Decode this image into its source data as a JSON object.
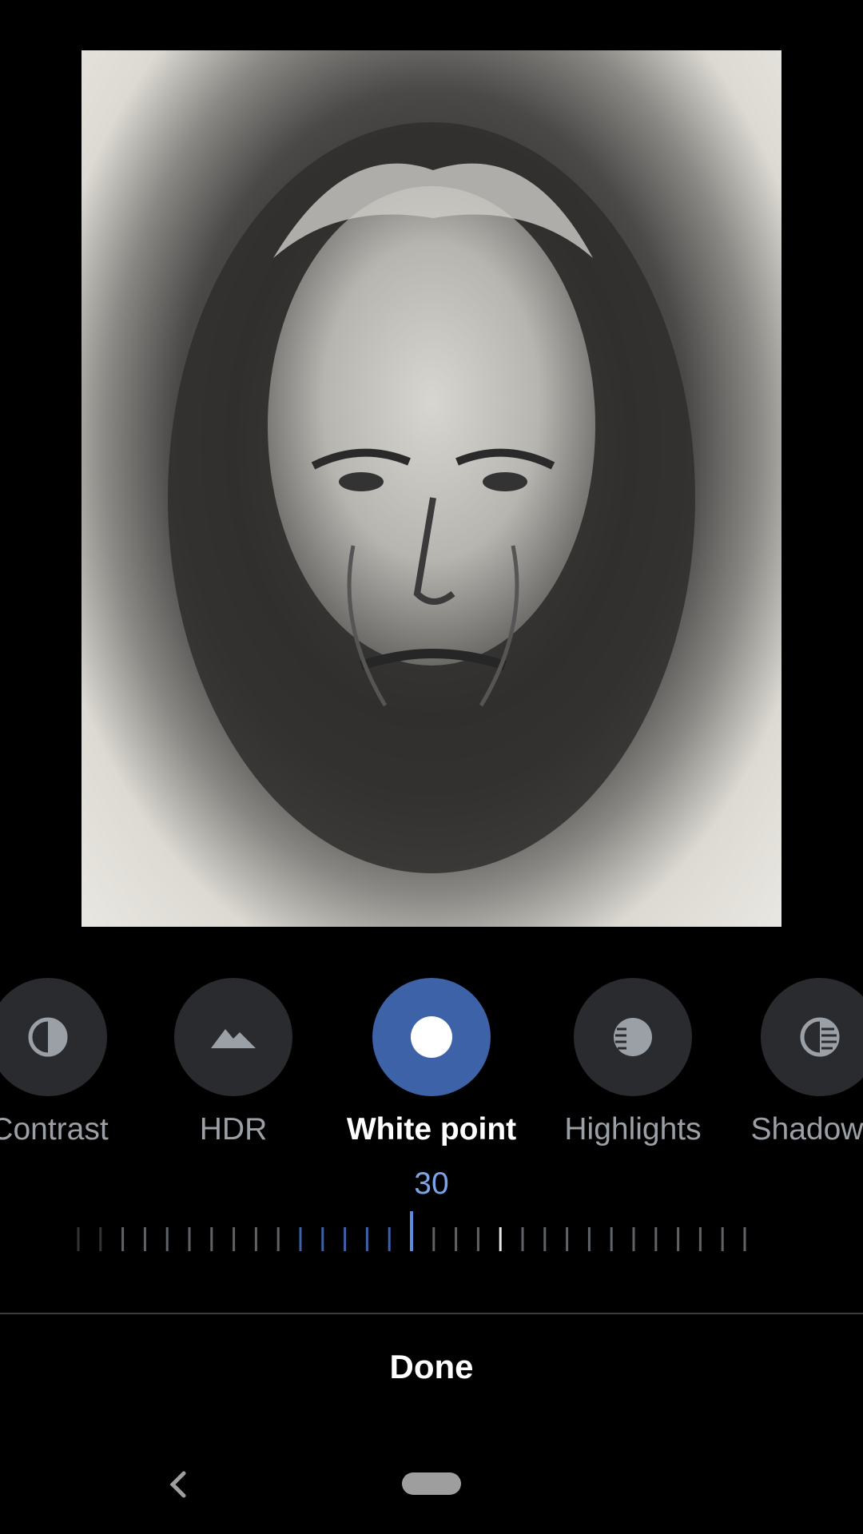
{
  "tools": [
    {
      "label": "Contrast",
      "icon": "contrast-icon",
      "active": false
    },
    {
      "label": "HDR",
      "icon": "mountain-icon",
      "active": false
    },
    {
      "label": "White point",
      "icon": "white-point-icon",
      "active": true
    },
    {
      "label": "Highlights",
      "icon": "highlights-icon",
      "active": false
    },
    {
      "label": "Shadow",
      "icon": "shadows-icon",
      "active": false
    }
  ],
  "slider": {
    "value": "30"
  },
  "done_label": "Done",
  "nav": {
    "back_icon": "back-icon",
    "home_icon": "home-pill-icon"
  },
  "colors": {
    "accent": "#3d62a8",
    "value_text": "#7ba4e8",
    "tool_bg": "#2a2b2e"
  }
}
